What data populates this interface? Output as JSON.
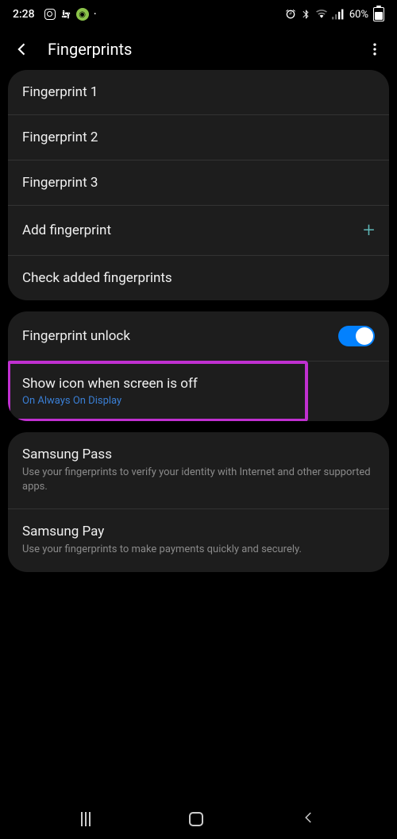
{
  "status_bar": {
    "time": "2:28",
    "battery_pct": "60%"
  },
  "header": {
    "title": "Fingerprints"
  },
  "groups": [
    {
      "items": [
        {
          "title": "Fingerprint 1"
        },
        {
          "title": "Fingerprint 2"
        },
        {
          "title": "Fingerprint 3"
        },
        {
          "title": "Add fingerprint",
          "plus": true
        },
        {
          "title": "Check added fingerprints"
        }
      ]
    },
    {
      "items": [
        {
          "title": "Fingerprint unlock",
          "toggle": true
        },
        {
          "title": "Show icon when screen is off",
          "sub_blue": "On Always On Display",
          "highlight": true
        }
      ]
    },
    {
      "items": [
        {
          "title": "Samsung Pass",
          "sub": "Use your fingerprints to verify your identity with Internet and other supported apps."
        },
        {
          "title": "Samsung Pay",
          "sub": "Use your fingerprints to make payments quickly and securely."
        }
      ]
    }
  ]
}
